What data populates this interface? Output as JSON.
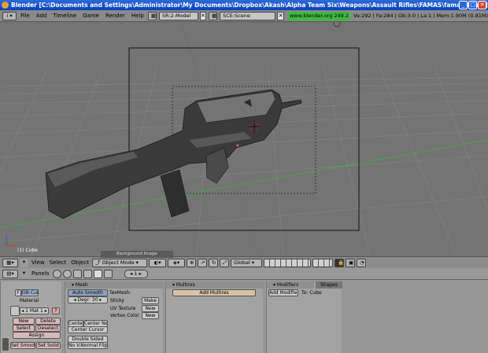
{
  "window": {
    "title": "Blender [C:\\Documents and Settings\\Administrator\\My Documents\\Dropbox\\Akash\\Alpha Team Six\\Weapons\\Assault Rifles\\FAMAS\\famas.blend]"
  },
  "menubar": {
    "items": [
      "File",
      "Add",
      "Timeline",
      "Game",
      "Render",
      "Help"
    ],
    "screen": "SR:2-Model",
    "scene": "SCE:Scene",
    "url": "www.blender.org 249.2",
    "stats": "Ve:292 | Fa:284 | Ob:3-0 | La:1 | Mem:1.90M (0.81M)"
  },
  "viewport": {
    "object_label": "(1) Cube"
  },
  "view_header": {
    "menus": [
      "View",
      "Select",
      "Object"
    ],
    "mode": "Object Mode",
    "orientation": "Global",
    "bg_image_tab": "Background Image"
  },
  "buttons_header": {
    "panels_label": "Panels",
    "frame": "1"
  },
  "link_panel": {
    "f": "F",
    "ob_name": "OB:Cube",
    "material_label": "Material",
    "mat_slot": "1 Mat 1",
    "q": "?",
    "new": "New",
    "delete": "Delete",
    "select": "Select",
    "deselect": "Deselect",
    "assign": "Assign",
    "set_smooth": "Set Smoot",
    "set_solid": "Set Solid"
  },
  "mesh_panel": {
    "title": "Mesh",
    "auto_smooth": "Auto Smooth",
    "degr": "Degr: 30",
    "texmesh": "TexMesh:",
    "sticky": "Sticky",
    "make": "Make",
    "uv_texture": "UV Texture",
    "new1": "New",
    "vertex_color": "Vertex Color",
    "new2": "New",
    "center": "Center",
    "center_new": "Center Ne",
    "center_cursor": "Center Cursor",
    "double_sided": "Double Sided",
    "no_v_normal_flip": "No V.Normal Flip"
  },
  "multires_panel": {
    "title": "Multires",
    "add_multires": "Add Multires"
  },
  "modifiers_panel": {
    "tab_modifiers": "Modifiers",
    "tab_shapes": "Shapes",
    "add_modifier": "Add Modifier",
    "to": "To: Cube"
  },
  "colors": {
    "titlebar": "#1f59d0",
    "url_bg": "#3fb83f",
    "viewport_bg": "#747474",
    "grid": "#8c8c8c"
  }
}
